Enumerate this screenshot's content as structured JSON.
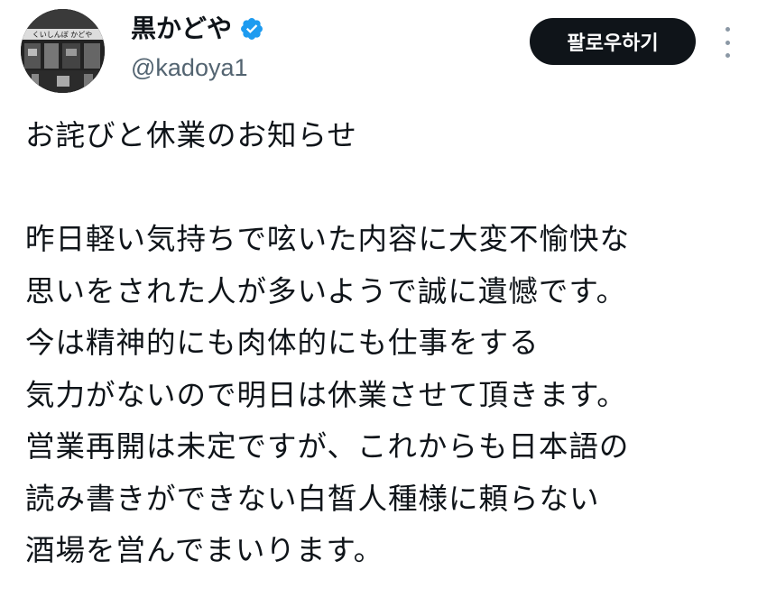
{
  "author": {
    "display_name": "黒かどや",
    "handle": "@kadoya1",
    "verified": true,
    "avatar_icon": "storefront-photo-avatar",
    "avatar_sign_text": "くいしんぼ かどや"
  },
  "actions": {
    "follow_label": "팔로우하기",
    "more_icon": "vertical-dots-icon"
  },
  "tweet": {
    "lines": [
      "お詫びと休業のお知らせ",
      "",
      "昨日軽い気持ちで呟いた内容に大変不愉快な",
      "思いをされた人が多いようで誠に遺憾です。",
      "今は精神的にも肉体的にも仕事をする",
      "気力がないので明日は休業させて頂きます。",
      "営業再開は未定ですが、これからも日本語の",
      "読み書きができない白皙人種様に頼らない",
      "酒場を営んでまいります。"
    ]
  },
  "colors": {
    "text_primary": "#0f1419",
    "text_secondary": "#536471",
    "verified_blue": "#1d9bf0",
    "follow_bg": "#0f1419",
    "follow_text": "#ffffff",
    "background": "#ffffff"
  }
}
